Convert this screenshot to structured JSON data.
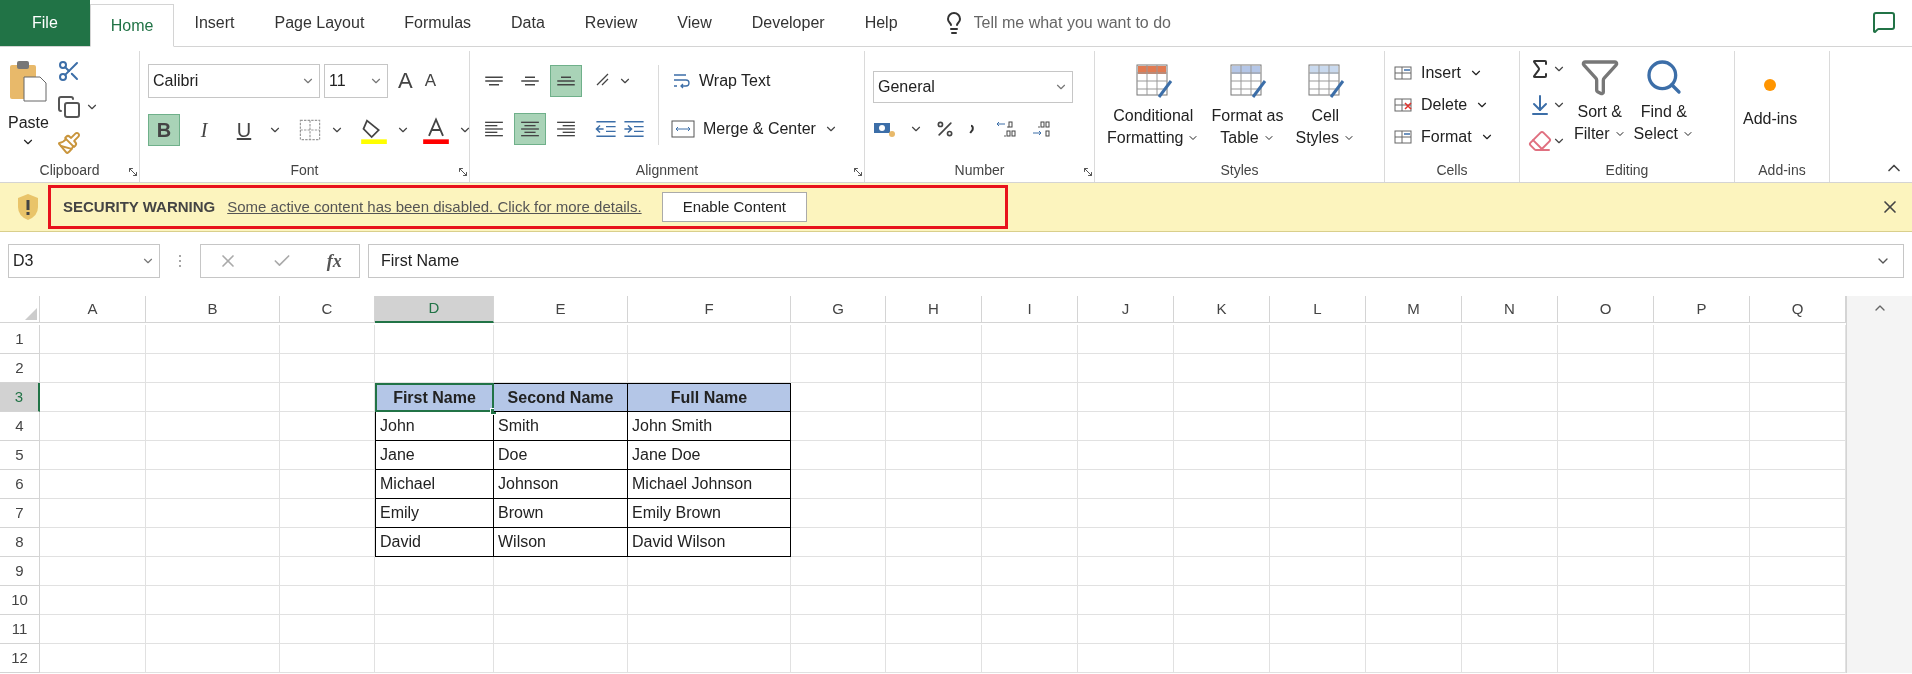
{
  "tabs": [
    {
      "label": "File",
      "kind": "file",
      "selected": false
    },
    {
      "label": "Home",
      "kind": "tab",
      "selected": true
    },
    {
      "label": "Insert",
      "kind": "tab",
      "selected": false
    },
    {
      "label": "Page Layout",
      "kind": "tab",
      "selected": false
    },
    {
      "label": "Formulas",
      "kind": "tab",
      "selected": false
    },
    {
      "label": "Data",
      "kind": "tab",
      "selected": false
    },
    {
      "label": "Review",
      "kind": "tab",
      "selected": false
    },
    {
      "label": "View",
      "kind": "tab",
      "selected": false
    },
    {
      "label": "Developer",
      "kind": "tab",
      "selected": false
    },
    {
      "label": "Help",
      "kind": "tab",
      "selected": false
    }
  ],
  "tell_me": {
    "placeholder": "Tell me what you want to do"
  },
  "ribbon": {
    "clipboard": {
      "label": "Clipboard",
      "paste": "Paste"
    },
    "font": {
      "label": "Font",
      "name": "Calibri",
      "size": "11",
      "grow": "A",
      "shrink": "A",
      "styles": [
        {
          "label": "B",
          "kind": "bold",
          "selected": true
        },
        {
          "label": "I",
          "kind": "italic",
          "selected": false
        },
        {
          "label": "U",
          "kind": "underline",
          "selected": false
        }
      ]
    },
    "alignment": {
      "label": "Alignment",
      "vertical": [
        {
          "kind": "top",
          "selected": false
        },
        {
          "kind": "middle",
          "selected": false
        },
        {
          "kind": "bottom",
          "selected": true
        }
      ],
      "horizontal": [
        {
          "kind": "left",
          "selected": false
        },
        {
          "kind": "center",
          "selected": true
        },
        {
          "kind": "right",
          "selected": false
        }
      ],
      "wrap_text": "Wrap Text",
      "merge": "Merge & Center"
    },
    "number": {
      "label": "Number",
      "format": "General"
    },
    "styles": {
      "label": "Styles",
      "buttons": [
        {
          "lines": [
            "Conditional",
            "Formatting"
          ]
        },
        {
          "lines": [
            "Format as",
            "Table"
          ]
        },
        {
          "lines": [
            "Cell",
            "Styles"
          ]
        }
      ]
    },
    "cells": {
      "label": "Cells",
      "buttons": [
        "Insert",
        "Delete",
        "Format"
      ]
    },
    "editing": {
      "label": "Editing",
      "buttons": [
        {
          "lines": [
            "Sort &",
            "Filter"
          ]
        },
        {
          "lines": [
            "Find &",
            "Select"
          ]
        }
      ]
    },
    "addins": {
      "label": "Add-ins",
      "button": "Add-ins"
    }
  },
  "security_bar": {
    "title": "SECURITY WARNING",
    "message": "Some active content has been disabled. Click for more details.",
    "button": "Enable Content"
  },
  "formula_bar": {
    "name_box": "D3",
    "function_button": "fx",
    "value": "First Name"
  },
  "sheet": {
    "columns": [
      {
        "label": "A",
        "selected": false
      },
      {
        "label": "B",
        "selected": false
      },
      {
        "label": "C",
        "selected": false
      },
      {
        "label": "D",
        "selected": true
      },
      {
        "label": "E",
        "selected": false
      },
      {
        "label": "F",
        "selected": false
      },
      {
        "label": "G",
        "selected": false
      },
      {
        "label": "H",
        "selected": false
      },
      {
        "label": "I",
        "selected": false
      },
      {
        "label": "J",
        "selected": false
      },
      {
        "label": "K",
        "selected": false
      },
      {
        "label": "L",
        "selected": false
      },
      {
        "label": "M",
        "selected": false
      },
      {
        "label": "N",
        "selected": false
      },
      {
        "label": "O",
        "selected": false
      },
      {
        "label": "P",
        "selected": false
      },
      {
        "label": "Q",
        "selected": false
      }
    ],
    "rows": [
      {
        "label": "1",
        "selected": false
      },
      {
        "label": "2",
        "selected": false
      },
      {
        "label": "3",
        "selected": true
      },
      {
        "label": "4",
        "selected": false
      },
      {
        "label": "5",
        "selected": false
      },
      {
        "label": "6",
        "selected": false
      },
      {
        "label": "7",
        "selected": false
      },
      {
        "label": "8",
        "selected": false
      },
      {
        "label": "9",
        "selected": false
      },
      {
        "label": "10",
        "selected": false
      },
      {
        "label": "11",
        "selected": false
      },
      {
        "label": "12",
        "selected": false
      }
    ],
    "table": {
      "header": [
        {
          "text": "First Name",
          "selected": true
        },
        {
          "text": "Second Name",
          "selected": false
        },
        {
          "text": "Full Name",
          "selected": false
        }
      ],
      "rows": [
        [
          "John",
          "Smith",
          "John Smith"
        ],
        [
          "Jane",
          "Doe",
          "Jane Doe"
        ],
        [
          "Michael",
          "Johnson",
          "Michael Johnson"
        ],
        [
          "Emily",
          "Brown",
          "Emily Brown"
        ],
        [
          "David",
          "Wilson",
          "David Wilson"
        ]
      ]
    }
  }
}
